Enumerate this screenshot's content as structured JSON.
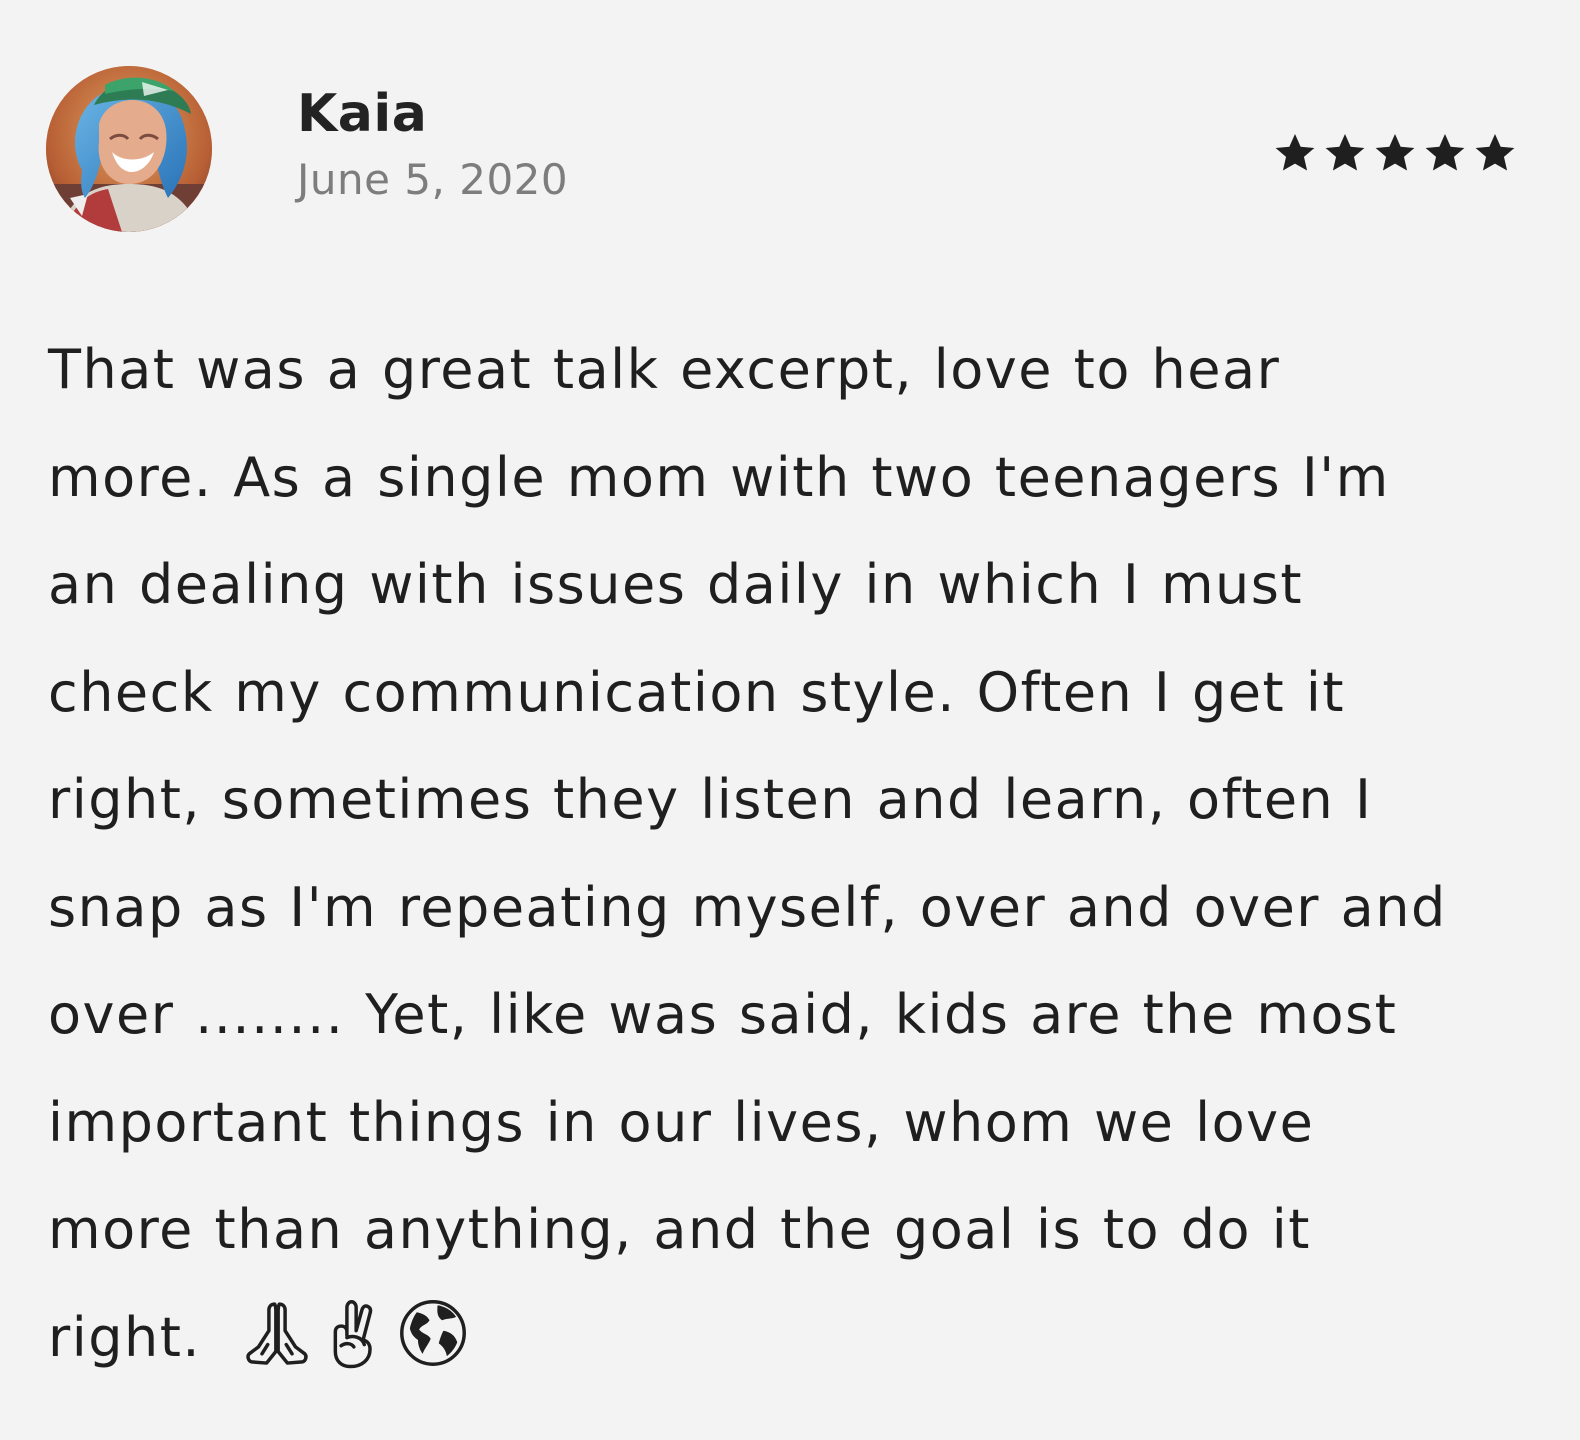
{
  "review": {
    "author": "Kaia",
    "date": "June 5, 2020",
    "rating": 5,
    "rating_max": 5,
    "body_lines": [
      "That was a great talk excerpt, love to hear",
      "more. As a single mom with two teenagers I'm",
      "an dealing with issues daily in which I must",
      "check my communication style. Often I get it",
      "right, sometimes they listen and learn, often I",
      "snap as I'm repeating myself, over and over and",
      "over ........ Yet, like was said, kids are the most",
      "important things in our lives, whom we love",
      "more than anything, and the goal is to do it",
      "right."
    ],
    "emojis": [
      "folded-hands-icon",
      "victory-hand-icon",
      "globe-americas-icon"
    ]
  },
  "colors": {
    "background": "#f3f3f3",
    "text": "#1f1f1f",
    "date": "#7d7d7d",
    "stars": "#1f1f1f"
  }
}
